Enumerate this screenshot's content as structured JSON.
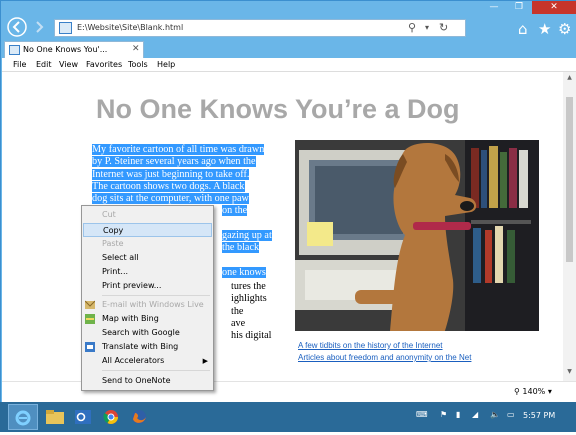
{
  "window": {
    "minimize": "—",
    "maximize": "❐",
    "close": "✕"
  },
  "address": {
    "url": "E:\\Website\\Site\\Blank.html"
  },
  "tab": {
    "label": "No One Knows You'...",
    "close": "✕"
  },
  "menu": [
    "File",
    "Edit",
    "View",
    "Favorites",
    "Tools",
    "Help"
  ],
  "page": {
    "title": "No One Knows You’re a Dog",
    "para_selected_lines": [
      "My favorite cartoon of all time was drawn",
      "by P. Steiner several years ago when the",
      "Internet was just beginning to take off.",
      "The cartoon shows two dogs. A black",
      "dog sits at the computer, with one paw",
      "on the keyboard. A",
      "gazing up at",
      "the black dog.",
      "one knows"
    ],
    "para_tail": [
      "tures the",
      "ighlights the",
      "ave",
      "his digital"
    ],
    "links": [
      "A few tidbits on the history of the Internet",
      "Articles about freedom and anonymity on the Net"
    ]
  },
  "context_menu": {
    "items": [
      {
        "label": "Cut",
        "disabled": true
      },
      {
        "label": "Copy",
        "highlighted": true
      },
      {
        "label": "Paste",
        "disabled": true
      },
      {
        "label": "Select all"
      },
      {
        "label": "Print..."
      },
      {
        "label": "Print preview..."
      },
      {
        "label": "E-mail with Windows Live",
        "disabled": true,
        "icon": "windows-live-icon"
      },
      {
        "label": "Map with Bing",
        "icon": "bing-map-icon"
      },
      {
        "label": "Search with Google"
      },
      {
        "label": "Translate with Bing",
        "icon": "bing-translate-icon"
      },
      {
        "label": "All Accelerators",
        "submenu": true
      },
      {
        "label": "Send to OneNote"
      }
    ]
  },
  "status": {
    "zoom": "140%"
  },
  "taskbar": {
    "clock": "5:57 PM"
  },
  "colors": {
    "selection": "#3399ff",
    "link": "#1a5fbf",
    "title": "#a8a8a8",
    "chrome": "#6ab6e8"
  }
}
